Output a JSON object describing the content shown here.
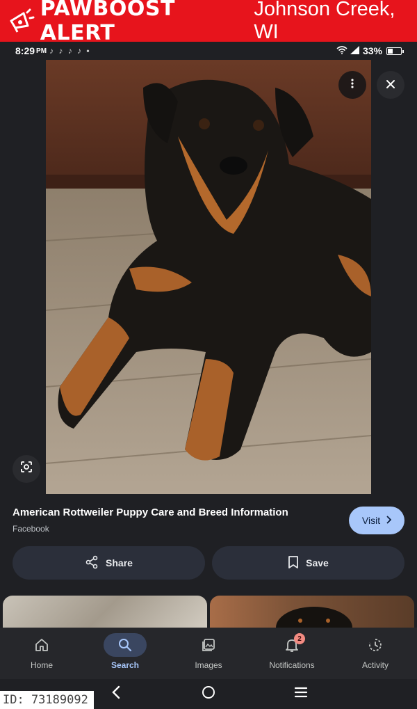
{
  "banner": {
    "brand": "PAWBOOST ALERT",
    "location": "Johnson Creek, WI",
    "icon": "megaphone-icon",
    "color": "#e7141c"
  },
  "status_bar": {
    "time": "8:29",
    "ampm": "PM",
    "battery": "33%",
    "battery_level": 0.33,
    "notification_icons": "♪ ♪ ♪ ♪ •"
  },
  "result": {
    "title": "American Rottweiler Puppy Care and Breed Information",
    "source": "Facebook",
    "visit_label": "Visit"
  },
  "actions": {
    "share_label": "Share",
    "save_label": "Save"
  },
  "bottom_nav": {
    "items": [
      {
        "label": "Home",
        "icon": "home-icon"
      },
      {
        "label": "Search",
        "icon": "search-icon",
        "active": true
      },
      {
        "label": "Images",
        "icon": "images-icon"
      },
      {
        "label": "Notifications",
        "icon": "bell-icon",
        "badge": "2"
      },
      {
        "label": "Activity",
        "icon": "activity-icon"
      }
    ]
  },
  "id_tag": "ID: 73189092",
  "colors": {
    "accent": "#a8c7fa",
    "background": "#1f2024",
    "badge": "#f28b82"
  }
}
